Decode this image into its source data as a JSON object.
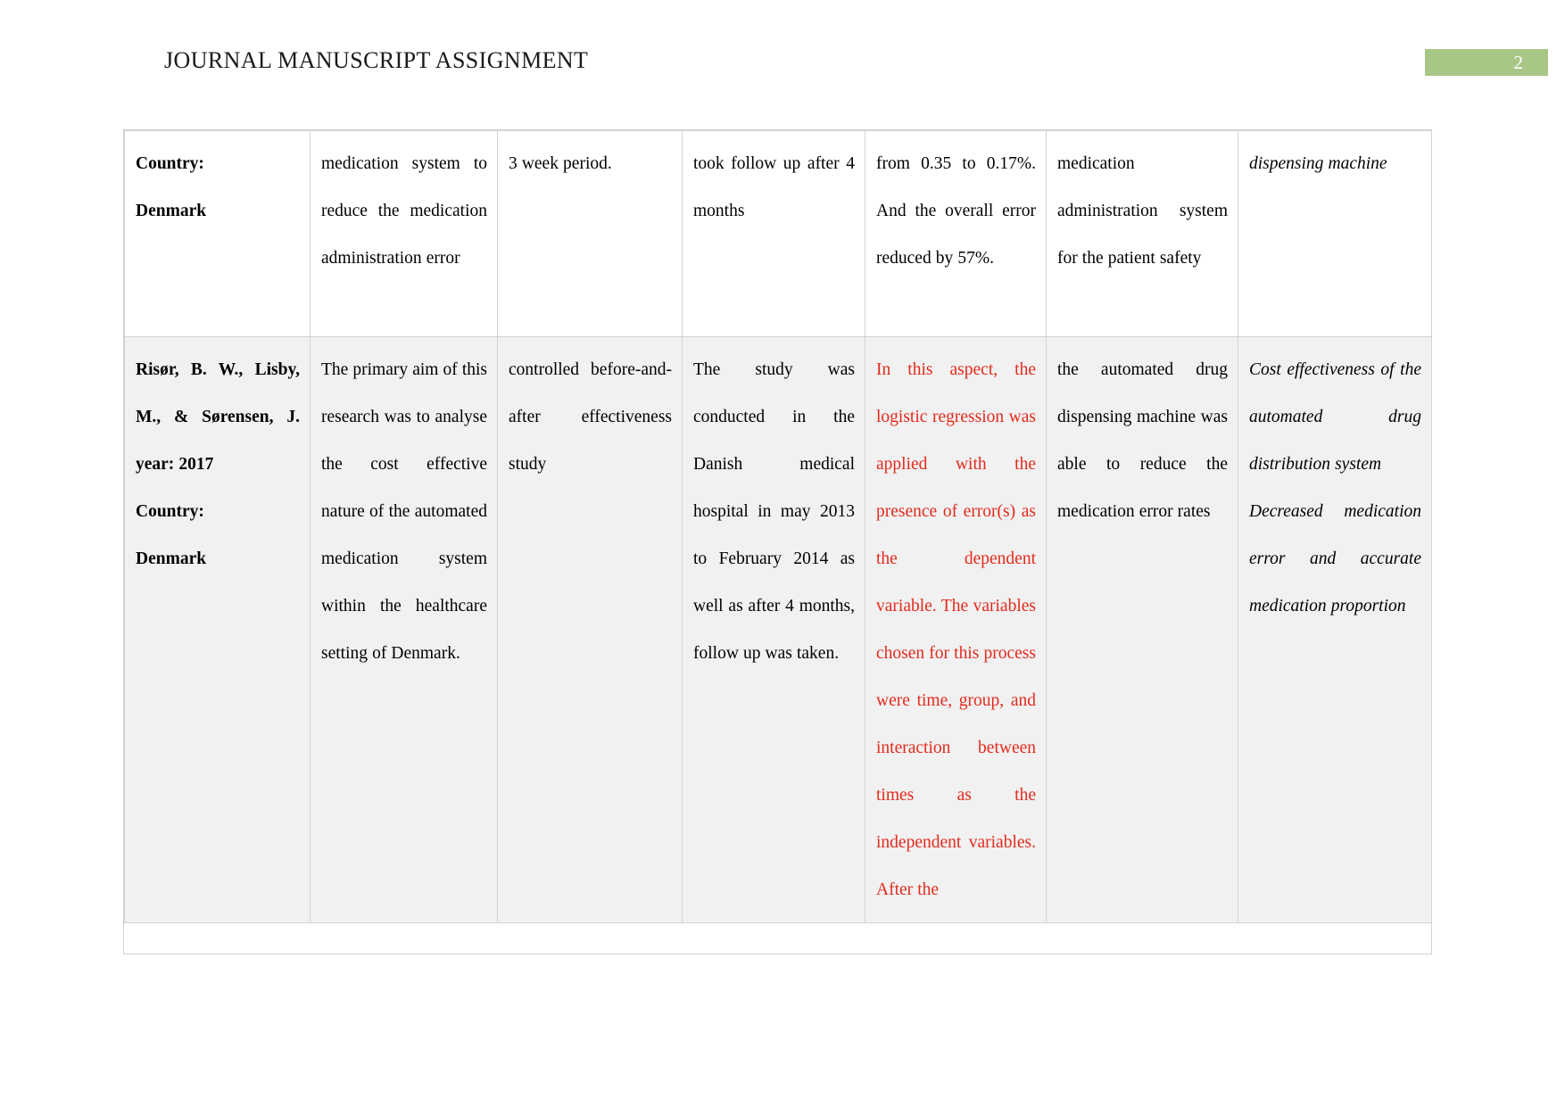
{
  "header": {
    "title": "JOURNAL MANUSCRIPT ASSIGNMENT",
    "page_number": "2",
    "badge_color": "#a8c686"
  },
  "table": {
    "columns": 7,
    "rows": [
      {
        "style": "white",
        "cells": [
          {
            "text": "Country:\nDenmark",
            "format": "bold"
          },
          {
            "text": "medication system to reduce the medication administration error",
            "format": "normal"
          },
          {
            "text": "3 week period.",
            "format": "normal"
          },
          {
            "text": "took follow up after 4 months",
            "format": "normal"
          },
          {
            "text": "from 0.35 to 0.17%. And the overall error reduced by 57%.",
            "format": "normal"
          },
          {
            "text": "medication administration system for the patient safety",
            "format": "normal"
          },
          {
            "text": "dispensing machine",
            "format": "italic"
          }
        ]
      },
      {
        "style": "gray",
        "cells": [
          {
            "text": "Risør, B. W., Lisby, M., & Sørensen, J. year: 2017\nCountry:\nDenmark",
            "format": "bold"
          },
          {
            "text": "The primary aim of this research was to analyse the cost effective nature of the automated medication system within the healthcare setting of Denmark.",
            "format": "normal"
          },
          {
            "text": "controlled before-and-after effectiveness study",
            "format": "normal"
          },
          {
            "text": "The study was conducted in the Danish medical hospital in may 2013 to February 2014 as well as after 4 months, follow up was taken.",
            "format": "normal"
          },
          {
            "text": "In this aspect, the logistic regression was applied with the presence of error(s) as the dependent variable. The variables chosen for this process were time, group, and interaction between times as the independent variables. After the",
            "format": "red"
          },
          {
            "text": "the automated drug dispensing machine was able to reduce the medication error rates",
            "format": "normal"
          },
          {
            "text": "Cost effectiveness of the automated drug distribution system\nDecreased medication error and accurate medication proportion",
            "format": "italic"
          }
        ]
      }
    ]
  },
  "colors": {
    "red_text": "#e32a1c",
    "row_shade": "#f1f1f1",
    "border": "#d2d2d2",
    "badge_green": "#a8c686"
  }
}
